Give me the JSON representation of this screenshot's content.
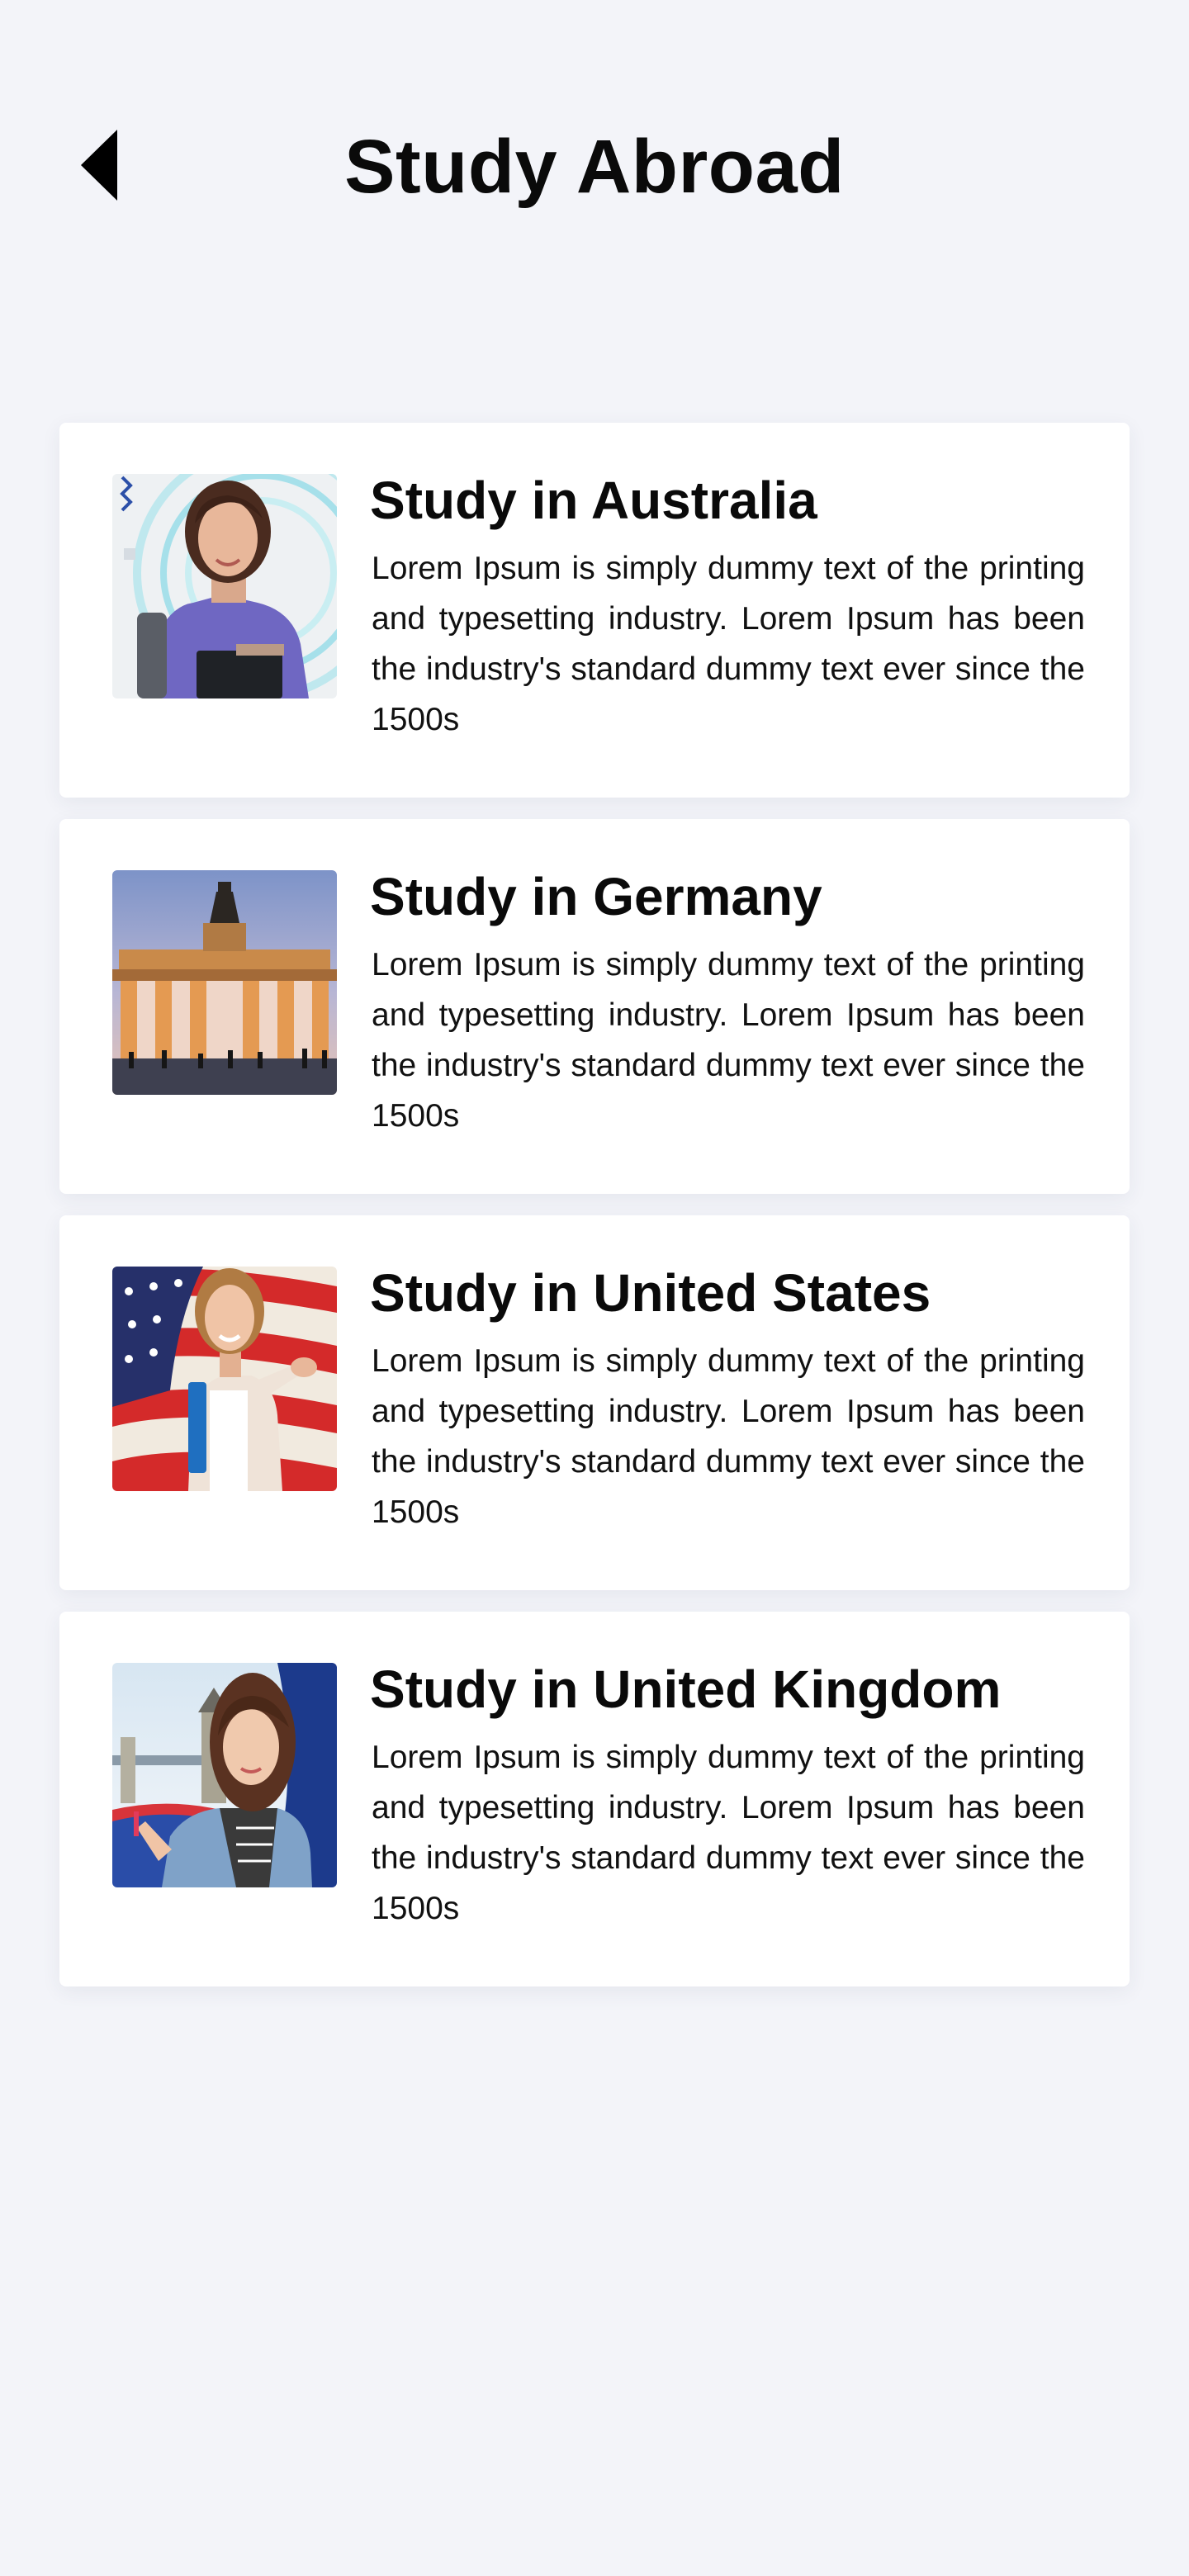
{
  "header": {
    "title": "Study Abroad",
    "back_icon": "back-arrow-icon"
  },
  "colors": {
    "background": "#f3f4f9",
    "card": "#ffffff",
    "text": "#0a0a0a"
  },
  "cards": [
    {
      "title": "Study in Australia",
      "description": "Lorem Ipsum is simply dummy text of the printing and typesetting industry. Lorem Ipsum has been the industry's standard dummy text ever since the 1500s",
      "image": "student-with-books-photo"
    },
    {
      "title": "Study in Germany",
      "description": "Lorem Ipsum is simply dummy text of the printing and typesetting industry. Lorem Ipsum has been the industry's standard dummy text ever since the 1500s",
      "image": "brandenburg-gate-photo"
    },
    {
      "title": "Study in United States",
      "description": "Lorem Ipsum is simply dummy text of the printing and typesetting industry. Lorem Ipsum has been the industry's standard dummy text ever since the 1500s",
      "image": "student-with-us-flag-photo"
    },
    {
      "title": "Study in United Kingdom",
      "description": "Lorem Ipsum is simply dummy text of the printing and typesetting industry. Lorem Ipsum has been the industry's standard dummy text ever since the 1500s",
      "image": "student-tower-bridge-photo"
    }
  ]
}
